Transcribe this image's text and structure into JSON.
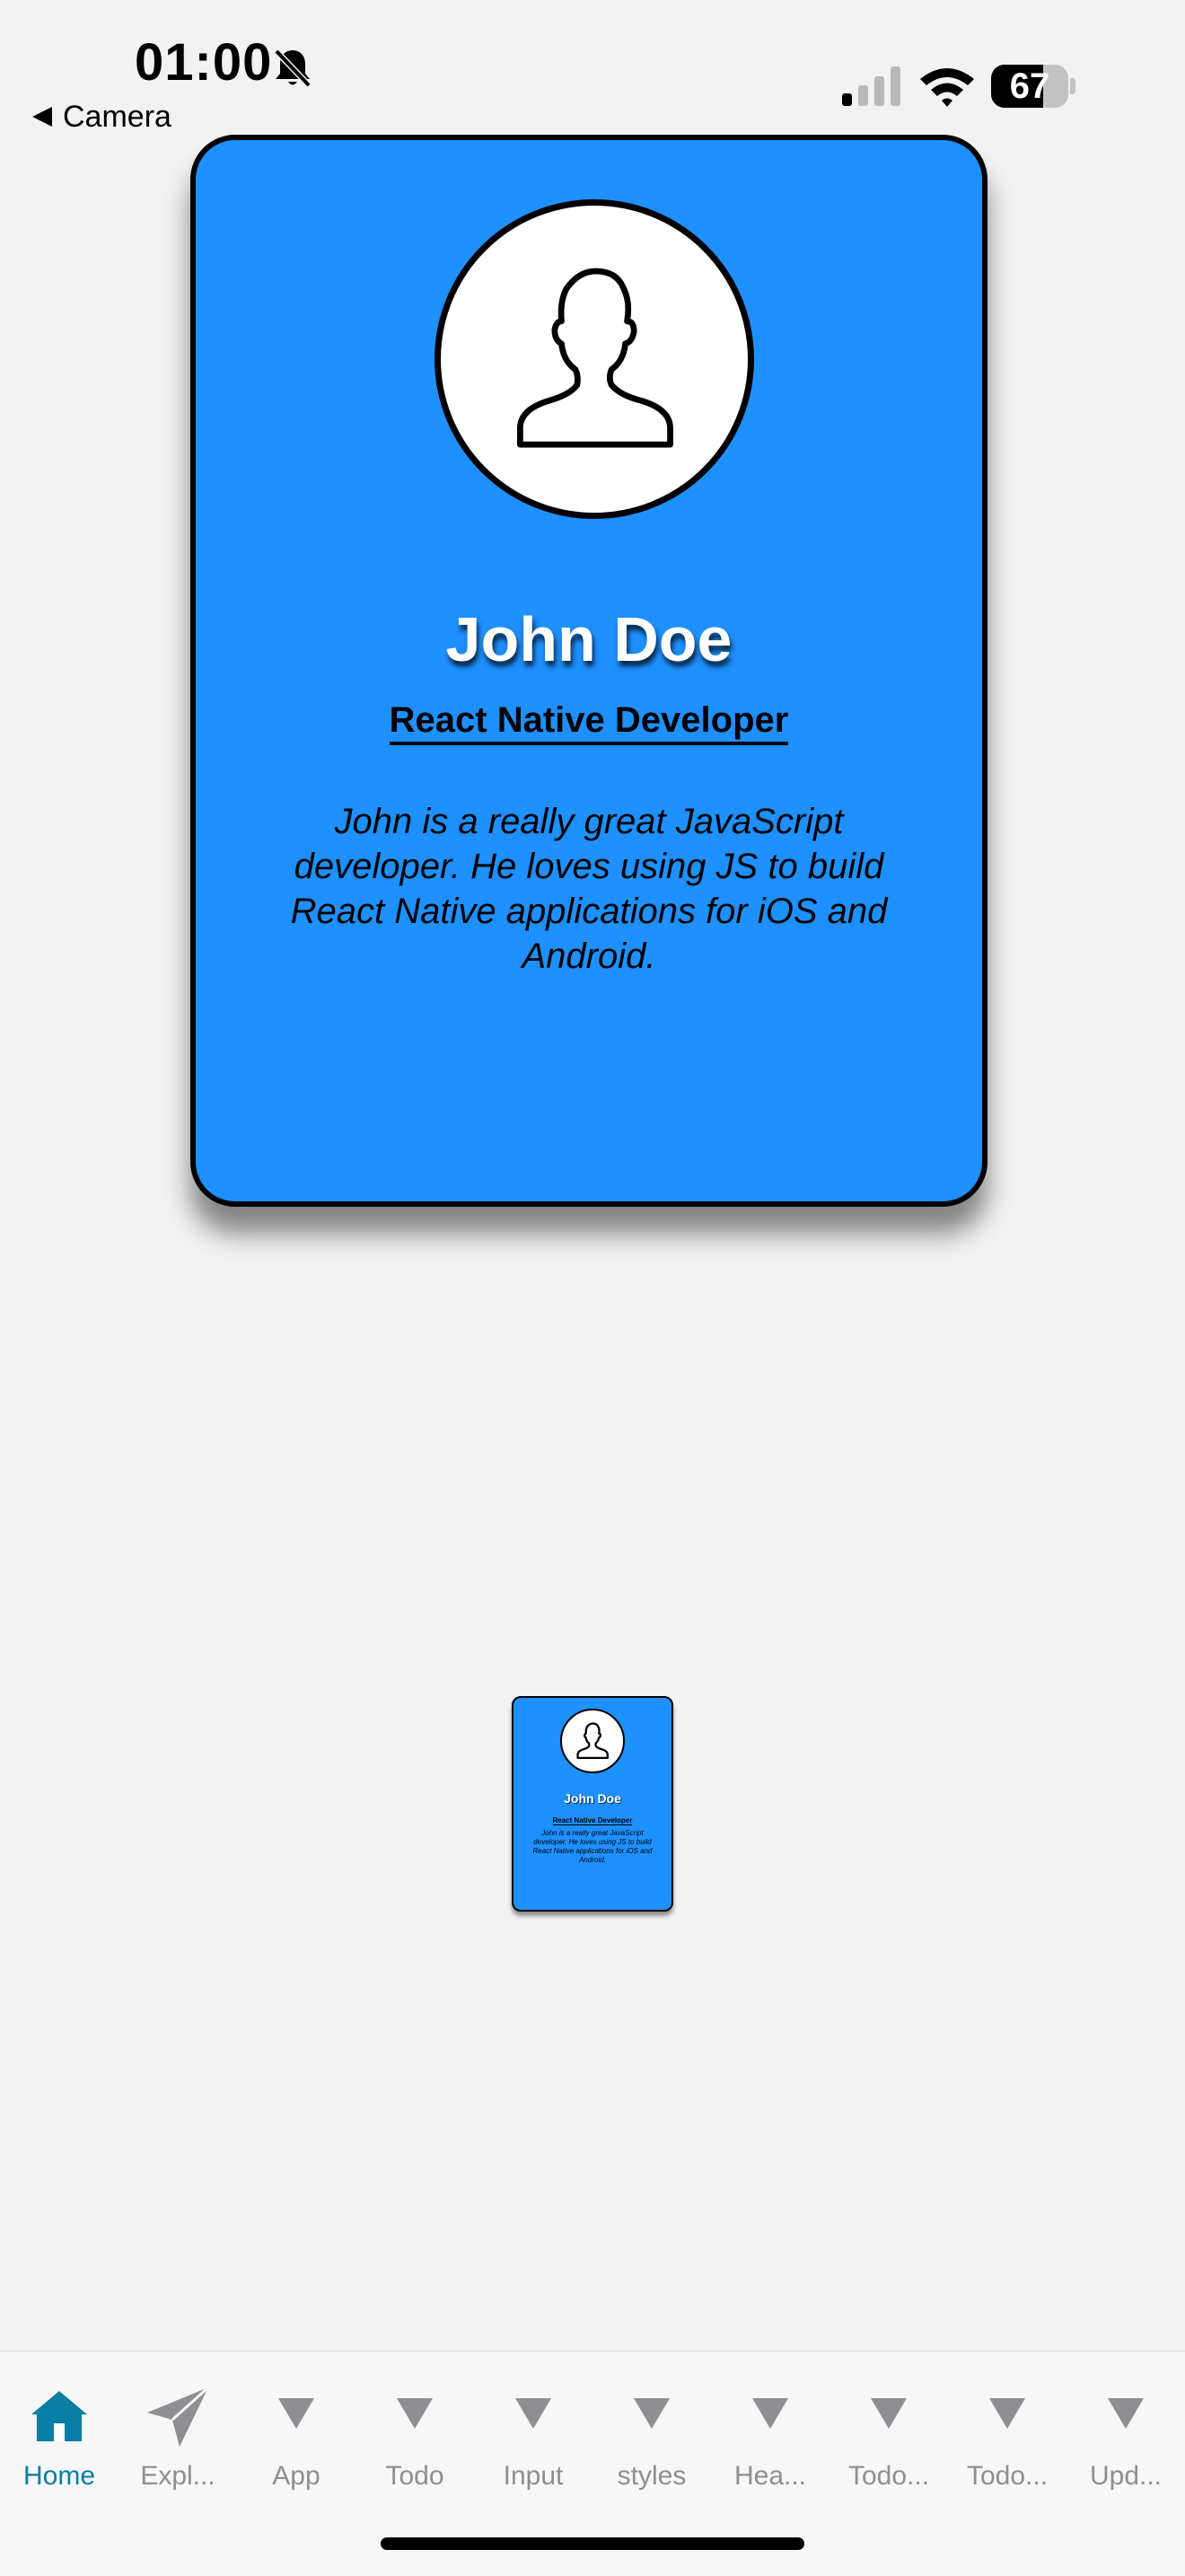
{
  "status_bar": {
    "time": "01:00",
    "back_label": "Camera",
    "battery_level": "67",
    "icons": [
      "bell-slash-icon",
      "signal-icon",
      "wifi-icon",
      "battery-icon"
    ]
  },
  "card": {
    "name": "John Doe",
    "role": "React Native Developer",
    "bio": "John is a really great JavaScript developer. He loves using JS to build React Native applications for iOS and Android.",
    "background_color": "#1e90ff",
    "avatar_icon": "user-silhouette-icon"
  },
  "mini_card": {
    "name": "John Doe",
    "role": "React Native Developer",
    "bio": "John is a really great JavaScript developer. He loves using JS to build React Native applications for iOS and Android."
  },
  "tabs": [
    {
      "label": "Home",
      "icon": "house-icon",
      "active": true
    },
    {
      "label": "Expl...",
      "icon": "paper-plane-icon",
      "active": false
    },
    {
      "label": "App",
      "icon": "triangle-icon",
      "active": false
    },
    {
      "label": "Todo",
      "icon": "triangle-icon",
      "active": false
    },
    {
      "label": "Input",
      "icon": "triangle-icon",
      "active": false
    },
    {
      "label": "styles",
      "icon": "triangle-icon",
      "active": false
    },
    {
      "label": "Hea...",
      "icon": "triangle-icon",
      "active": false
    },
    {
      "label": "Todo...",
      "icon": "triangle-icon",
      "active": false
    },
    {
      "label": "Todo...",
      "icon": "triangle-icon",
      "active": false
    },
    {
      "label": "Upd...",
      "icon": "triangle-icon",
      "active": false
    }
  ],
  "colors": {
    "accent": "#0a7ea4",
    "inactive_tab": "#8e8e93",
    "card_blue": "#1e90ff"
  }
}
